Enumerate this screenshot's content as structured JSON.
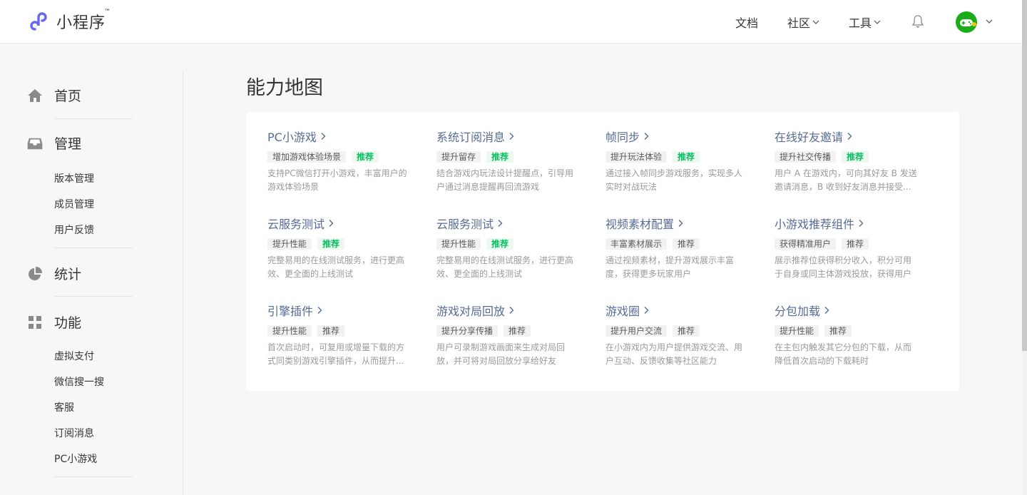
{
  "header": {
    "logo_text": "小程序",
    "logo_tm": "™",
    "nav": {
      "docs": "文档",
      "community": "社区",
      "tools": "工具"
    }
  },
  "sidebar": {
    "home": "首页",
    "manage": "管理",
    "manage_items": [
      "版本管理",
      "成员管理",
      "用户反馈"
    ],
    "stats": "统计",
    "features": "功能",
    "feature_items": [
      "虚拟支付",
      "微信搜一搜",
      "客服",
      "订阅消息",
      "PC小游戏"
    ]
  },
  "main": {
    "title": "能力地图",
    "features": [
      {
        "title": "PC小游戏",
        "tags": [
          {
            "text": "增加游戏体验场景",
            "type": "plain"
          },
          {
            "text": "推荐",
            "type": "rec"
          }
        ],
        "desc": "支持PC微信打开小游戏，丰富用户的游戏体验场景"
      },
      {
        "title": "系统订阅消息",
        "tags": [
          {
            "text": "提升留存",
            "type": "plain"
          },
          {
            "text": "推荐",
            "type": "rec"
          }
        ],
        "desc": "结合游戏内玩法设计提醒点，引导用户通过消息提醒再回流游戏"
      },
      {
        "title": "帧同步",
        "tags": [
          {
            "text": "提升玩法体验",
            "type": "plain"
          },
          {
            "text": "推荐",
            "type": "rec"
          }
        ],
        "desc": "通过接入帧同步游戏服务，实现多人实时对战玩法"
      },
      {
        "title": "在线好友邀请",
        "tags": [
          {
            "text": "提升社交传播",
            "type": "plain"
          },
          {
            "text": "推荐",
            "type": "rec"
          }
        ],
        "desc": "用户 A 在游戏内，可向其好友 B 发送邀请消息，B 收到好友消息并接受..."
      },
      {
        "title": "云服务测试",
        "tags": [
          {
            "text": "提升性能",
            "type": "plain"
          },
          {
            "text": "推荐",
            "type": "rec"
          }
        ],
        "desc": "完整易用的在线测试服务，进行更高效、更全面的上线测试"
      },
      {
        "title": "云服务测试",
        "tags": [
          {
            "text": "提升性能",
            "type": "plain"
          },
          {
            "text": "推荐",
            "type": "rec"
          }
        ],
        "desc": "完整易用的在线测试服务，进行更高效、更全面的上线测试"
      },
      {
        "title": "视频素材配置",
        "tags": [
          {
            "text": "丰富素材展示",
            "type": "plain"
          },
          {
            "text": "推荐",
            "type": "plain"
          }
        ],
        "desc": "通过视频素材，提升游戏展示丰富度，获得更多玩家用户"
      },
      {
        "title": "小游戏推荐组件",
        "tags": [
          {
            "text": "获得精准用户",
            "type": "plain"
          },
          {
            "text": "推荐",
            "type": "plain"
          }
        ],
        "desc": "展示推荐位获得积分收入，积分可用于自身或同主体游戏投放，获得用户"
      },
      {
        "title": "引擎插件",
        "tags": [
          {
            "text": "提升性能",
            "type": "plain"
          },
          {
            "text": "推荐",
            "type": "plain"
          }
        ],
        "desc": "首次启动时，可复用或增量下载的方式同类别游戏引擎插件，从而提升..."
      },
      {
        "title": "游戏对局回放",
        "tags": [
          {
            "text": "提升分享传播",
            "type": "plain"
          },
          {
            "text": "推荐",
            "type": "plain"
          }
        ],
        "desc": "用户可录制游戏画面来生成对局回放，并可将对局回放分享给好友"
      },
      {
        "title": "游戏圈",
        "tags": [
          {
            "text": "提升用户交流",
            "type": "plain"
          },
          {
            "text": "推荐",
            "type": "plain"
          }
        ],
        "desc": "在小游戏内为用户提供游戏交流、用户互动、反馈收集等社区能力"
      },
      {
        "title": "分包加载",
        "tags": [
          {
            "text": "提升性能",
            "type": "plain"
          },
          {
            "text": "推荐",
            "type": "plain"
          }
        ],
        "desc": "在主包内触发其它分包的下载，从而降低首次启动的下载耗时"
      }
    ]
  },
  "colors": {
    "link": "#576b95",
    "brand_green": "#07c160",
    "logo_purple": "#6467f0"
  }
}
